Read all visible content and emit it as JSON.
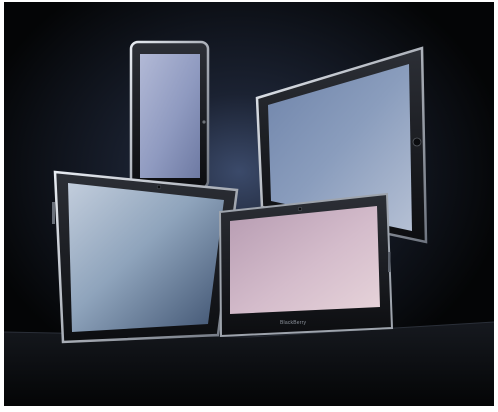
{
  "image": {
    "subject": "",
    "background_color": "#050608"
  },
  "tablets": [
    {
      "name": "tall-tablet-back",
      "screen_color": "#9aa4c4"
    },
    {
      "name": "ipad-right",
      "screen_color": "#7f93b6"
    },
    {
      "name": "motorola-left",
      "screen_color": "#8fa4bc"
    },
    {
      "name": "blackberry-playbook",
      "screen_color": "#c9aebc",
      "brand_text": "BlackBerry"
    }
  ]
}
